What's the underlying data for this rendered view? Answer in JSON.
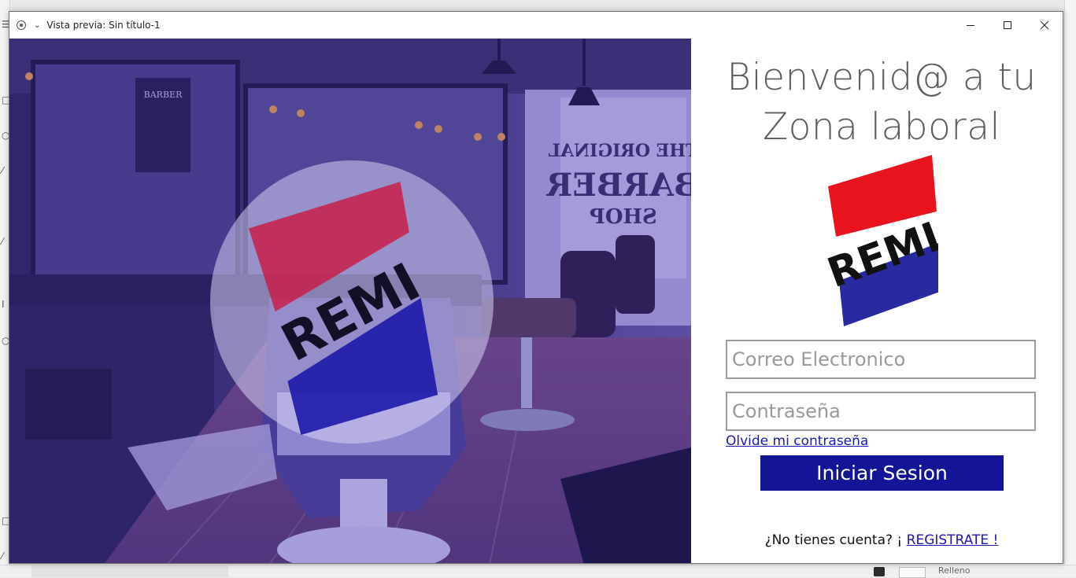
{
  "window": {
    "title": "Vista previa: Sin título-1",
    "controls": [
      "minimize",
      "maximize",
      "close"
    ]
  },
  "hero": {
    "logo_text": "REMI",
    "sign_text_1": "THE ORIGINAL",
    "sign_text_2": "BARBER",
    "sign_text_3": "SHOP",
    "overlay_color": "#3a2aa8"
  },
  "panel": {
    "welcome_line1": "Bienvenid@ a tu",
    "welcome_line2": "Zona laboral",
    "logo_text": "REMI",
    "email_placeholder": "Correo Electronico",
    "password_placeholder": "Contraseña",
    "forgot_link": "Olvide mi contraseña",
    "login_button": "Iniciar Sesion",
    "signup_prompt": "¿No tienes cuenta? ¡ ",
    "signup_link": "REGISTRATE !"
  },
  "background_app": {
    "bottom_label": "Relleno"
  },
  "colors": {
    "brand_red": "#e8141e",
    "brand_blue": "#2a2aa0",
    "button_blue": "#141496",
    "link_blue": "#1a1ab0"
  }
}
